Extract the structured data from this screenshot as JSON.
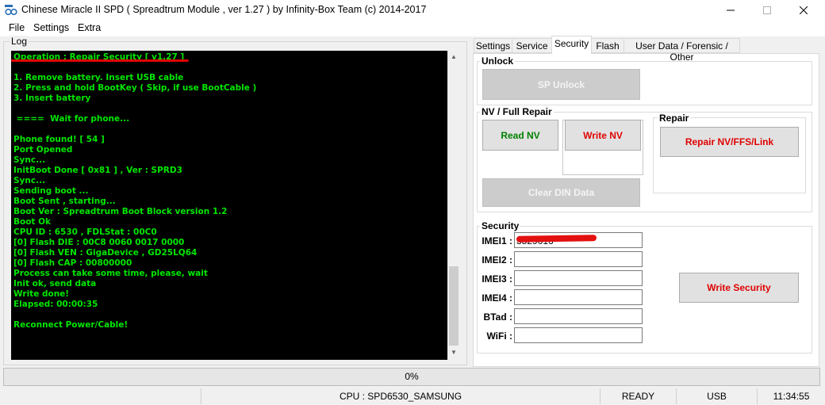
{
  "window": {
    "title": "Chinese Miracle II SPD ( Spreadtrum Module , ver 1.27 ) by Infinity-Box Team (c) 2014-2017"
  },
  "menu": [
    "File",
    "Settings",
    "Extra"
  ],
  "log": {
    "label": "Log",
    "lines": [
      "Operation : Repair Security [ v1.27 ]",
      "",
      "1. Remove battery. Insert USB cable",
      "2. Press and hold BootKey ( Skip, if use BootCable )",
      "3. Insert battery",
      "",
      " ====  Wait for phone...",
      "",
      "Phone found! [ 54 ]",
      "Port Opened",
      "Sync...",
      "InitBoot Done [ 0x81 ] , Ver : SPRD3",
      "Sync...",
      "Sending boot ...",
      "Boot Sent , starting...",
      "Boot Ver : Spreadtrum Boot Block version 1.2",
      "Boot Ok",
      "CPU ID : 6530 , FDLStat : 00C0",
      "[0] Flash DIE : 00C8 0060 0017 0000",
      "[0] Flash VEN : GigaDevice , GD25LQ64",
      "[0] Flash CAP : 00800000",
      "Process can take some time, please, wait",
      "Init ok, send data",
      "Write done!",
      "Elapsed: 00:00:35",
      "",
      "Reconnect Power/Cable!"
    ]
  },
  "tabs": [
    "Settings",
    "Service",
    "Security",
    "Flash",
    "User Data / Forensic / Other"
  ],
  "active_tab": "Security",
  "unlock": {
    "title": "Unlock",
    "sp_unlock": "SP Unlock"
  },
  "nv": {
    "title": "NV / Full Repair",
    "read": "Read NV",
    "write": "Write NV",
    "clear_din": "Clear DIN Data"
  },
  "repair": {
    "title": "Repair",
    "button": "Repair NV/FFS/Link"
  },
  "security": {
    "title": "Security",
    "fields": [
      {
        "label": "IMEI1 :",
        "value": "3529016"
      },
      {
        "label": "IMEI2 :",
        "value": ""
      },
      {
        "label": "IMEI3 :",
        "value": ""
      },
      {
        "label": "IMEI4 :",
        "value": ""
      },
      {
        "label": "BTad :",
        "value": ""
      },
      {
        "label": "WiFi :",
        "value": ""
      }
    ],
    "write_button": "Write Security"
  },
  "progress": {
    "text": "0%",
    "fraction": 0
  },
  "status": {
    "cpu": "CPU : SPD6530_SAMSUNG",
    "state": "READY",
    "port": "USB",
    "time": "11:34:55"
  },
  "colors": {
    "log_text": "#00e600",
    "log_bg": "#000000",
    "accent_red": "#e00000",
    "accent_green": "#008000"
  }
}
